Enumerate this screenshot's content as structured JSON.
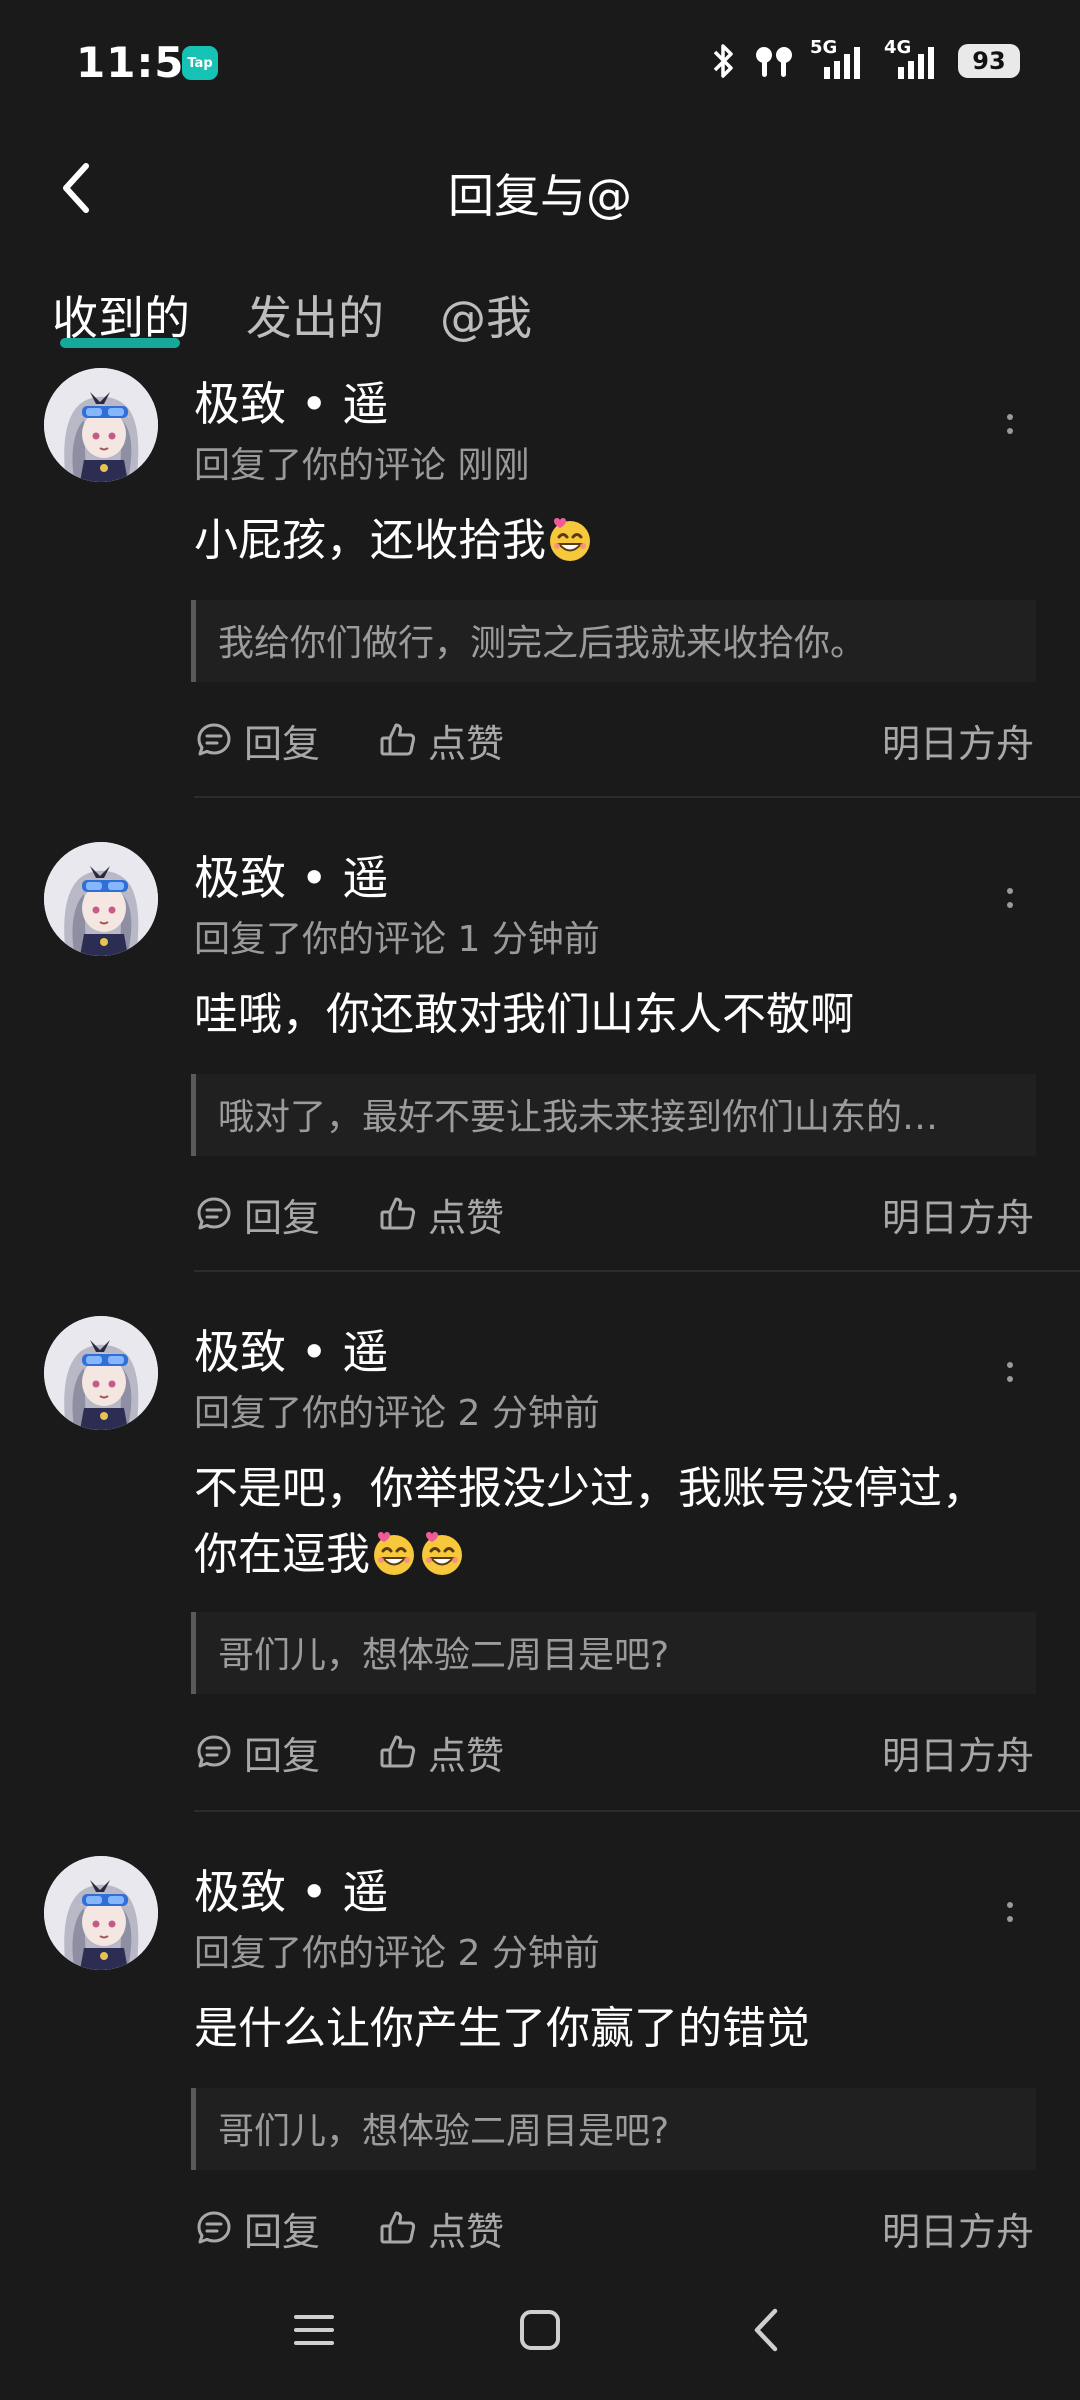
{
  "status_bar": {
    "time": "11:51",
    "app_badge": "Tap",
    "network_1": "5G",
    "network_2": "4G",
    "battery": "93"
  },
  "header": {
    "title": "回复与@",
    "back_icon": "chevron-left-icon"
  },
  "tabs": [
    {
      "label": "收到的",
      "active": true
    },
    {
      "label": "发出的",
      "active": false
    },
    {
      "label": "@我",
      "active": false
    }
  ],
  "colors": {
    "accent": "#16c2b3",
    "background": "#1a1a1a",
    "secondary_text": "#9a9a9a"
  },
  "comments": [
    {
      "username": "极致 • 遥",
      "meta": "回复了你的评论 刚刚",
      "text": "小屁孩，还收拾我",
      "emoji_count": 1,
      "quote": "我给你们做行，测完之后我就来收拾你。",
      "reply_label": "回复",
      "like_label": "点赞",
      "game": "明日方舟"
    },
    {
      "username": "极致 • 遥",
      "meta": "回复了你的评论 1 分钟前",
      "text": "哇哦，你还敢对我们山东人不敬啊",
      "emoji_count": 0,
      "quote": "哦对了，最好不要让我未来接到你们山东的…",
      "reply_label": "回复",
      "like_label": "点赞",
      "game": "明日方舟"
    },
    {
      "username": "极致 • 遥",
      "meta": "回复了你的评论 2 分钟前",
      "text_line1": "不是吧，你举报没少过，我账号没停过，",
      "text_line2": "你在逗我",
      "emoji_count": 2,
      "quote": "哥们儿，想体验二周目是吧?",
      "reply_label": "回复",
      "like_label": "点赞",
      "game": "明日方舟"
    },
    {
      "username": "极致 • 遥",
      "meta": "回复了你的评论 2 分钟前",
      "text": "是什么让你产生了你赢了的错觉",
      "emoji_count": 0,
      "quote": "哥们儿，想体验二周目是吧?",
      "reply_label": "回复",
      "like_label": "点赞",
      "game": "明日方舟"
    }
  ],
  "nav_bar": {
    "items": [
      "menu-icon",
      "home-icon",
      "back-icon"
    ]
  }
}
